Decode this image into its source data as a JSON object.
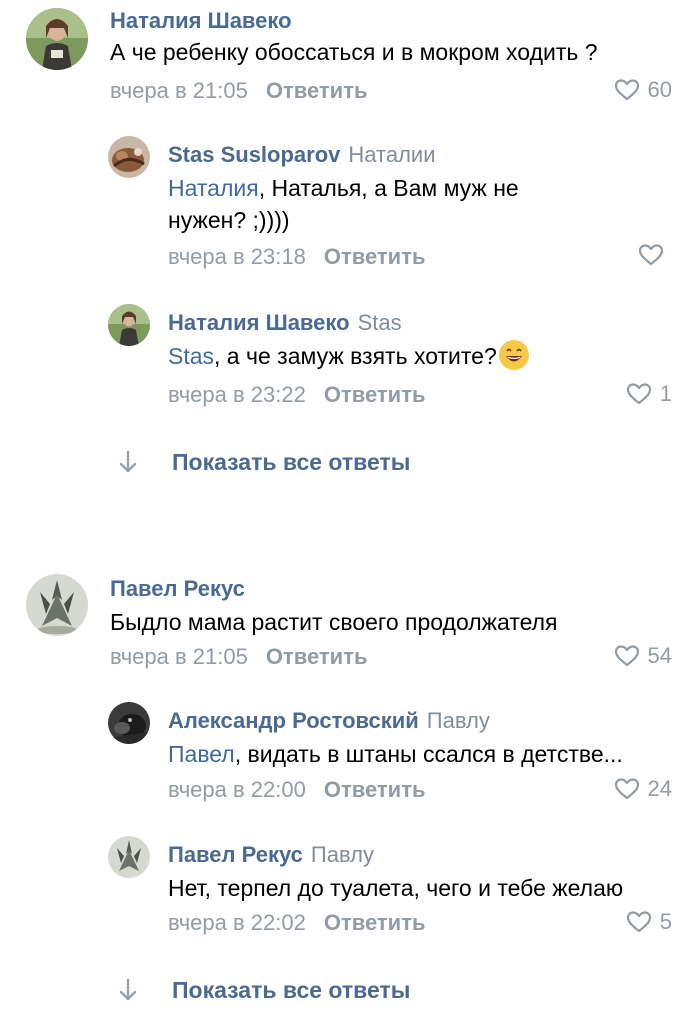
{
  "comments": [
    {
      "author": "Наталия Шавеко",
      "text": "А че ребенку обоссаться и в мокром ходить ?",
      "date": "вчера в 21:05",
      "reply_label": "Ответить",
      "likes": "60",
      "replies": [
        {
          "author": "Stas Susloparov",
          "reply_to": "Наталии",
          "mention": "Наталия",
          "text_line1": ", Наталья, а Вам муж не",
          "text_line2": "нужен? ;))))",
          "date": "вчера в 23:18",
          "reply_label": "Ответить",
          "likes": ""
        },
        {
          "author": "Наталия Шавеко",
          "reply_to": "Stas",
          "mention": "Stas",
          "text": ",  а че замуж взять хотите?",
          "emoji": "smile-emoji",
          "date": "вчера в 23:22",
          "reply_label": "Ответить",
          "likes": "1"
        }
      ],
      "show_all_label": "Показать все ответы"
    },
    {
      "author": "Павел Рекус",
      "text": "Быдло мама растит своего продолжателя",
      "date": "вчера в 21:05",
      "reply_label": "Ответить",
      "likes": "54",
      "replies": [
        {
          "author": "Александр Ростовский",
          "reply_to": "Павлу",
          "mention": "Павел",
          "text": ", видать в штаны ссался в детстве...",
          "date": "вчера в 22:00",
          "reply_label": "Ответить",
          "likes": "24"
        },
        {
          "author": "Павел Рекус",
          "reply_to": "Павлу",
          "text": "Нет, терпел до туалета, чего и тебе желаю",
          "date": "вчера в 22:02",
          "reply_label": "Ответить",
          "likes": "5"
        }
      ],
      "show_all_label": "Показать все ответы"
    }
  ],
  "colors": {
    "author": "#4a6a91",
    "mention": "#3f6a9e",
    "meta": "#939ba4",
    "reply_to": "#828d99"
  },
  "icons": {
    "like": "heart-outline-icon",
    "show_all": "arrow-down-icon"
  }
}
